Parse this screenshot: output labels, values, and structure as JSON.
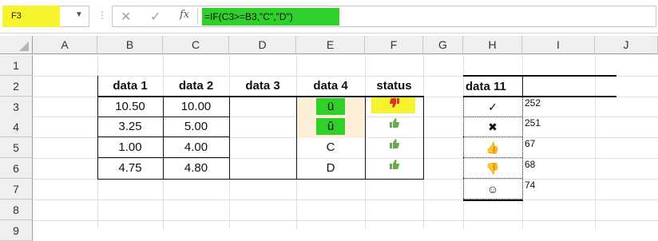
{
  "formula_bar": {
    "name_box": "F3",
    "formula": "=IF(C3>=B3,\"C\",\"D\")",
    "cancel_icon": "✕",
    "enter_icon": "✓",
    "fx_label": "fx"
  },
  "columns": [
    "A",
    "B",
    "C",
    "D",
    "E",
    "F",
    "G",
    "H",
    "I",
    "J"
  ],
  "rows": [
    "1",
    "2",
    "3",
    "4",
    "5",
    "6",
    "7",
    "8",
    "9"
  ],
  "table": {
    "headers": [
      "data 1",
      "data 2",
      "data 3",
      "data 4",
      "status"
    ],
    "rows": [
      {
        "d1": "10.50",
        "d2": "10.00",
        "d3": "",
        "d4": "ü",
        "status": "thumbs-down"
      },
      {
        "d1": "3.25",
        "d2": "5.00",
        "d3": "",
        "d4": "û",
        "status": "thumbs-up"
      },
      {
        "d1": "1.00",
        "d2": "4.00",
        "d3": "",
        "d4": "C",
        "status": "thumbs-up"
      },
      {
        "d1": "4.75",
        "d2": "4.80",
        "d3": "",
        "d4": "D",
        "status": "thumbs-up"
      }
    ]
  },
  "lookup": {
    "header": "data 11",
    "rows": [
      {
        "symbol": "check-icon",
        "glyph": "✓",
        "code": "252"
      },
      {
        "symbol": "cross-icon",
        "glyph": "✖",
        "code": "251"
      },
      {
        "symbol": "thumbs-up-icon",
        "glyph": "👍",
        "code": "67"
      },
      {
        "symbol": "thumbs-down-icon",
        "glyph": "👎",
        "code": "68"
      },
      {
        "symbol": "smiley-icon",
        "glyph": "☺",
        "code": "74"
      }
    ]
  },
  "colors": {
    "yellow_highlight": "#f7f22e",
    "green_highlight": "#2fd02a",
    "cell_highlight": "#fcefd7",
    "thumb_green": "#6aa84f",
    "thumb_red": "#e0322a"
  }
}
